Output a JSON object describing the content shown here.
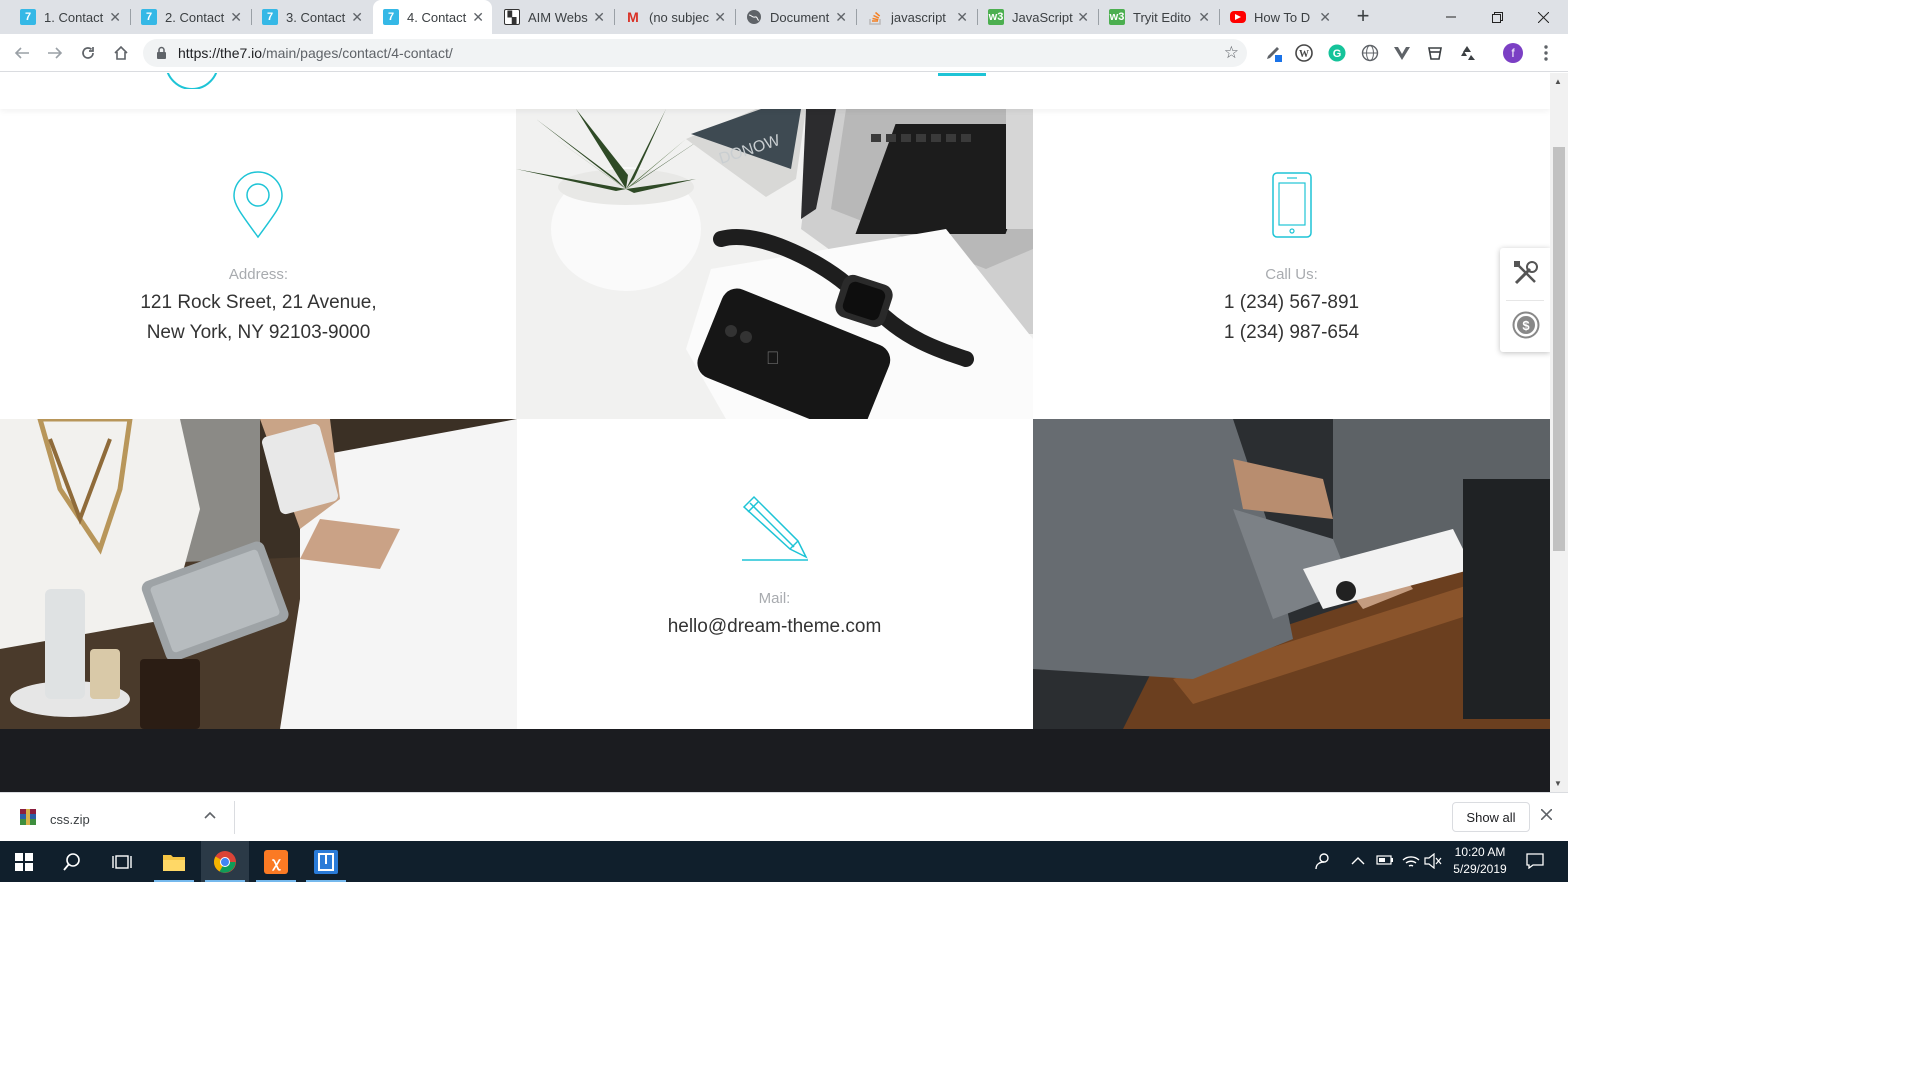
{
  "browser": {
    "tabs": [
      {
        "title": "1. Contact",
        "favicon": "the7-icon",
        "favicon_color": "#35b8e6",
        "favicon_text": "7",
        "active": false
      },
      {
        "title": "2. Contact",
        "favicon": "the7-icon",
        "favicon_color": "#35b8e6",
        "favicon_text": "7",
        "active": false
      },
      {
        "title": "3. Contact",
        "favicon": "the7-icon",
        "favicon_color": "#35b8e6",
        "favicon_text": "7",
        "active": false
      },
      {
        "title": "4. Contact",
        "favicon": "the7-icon",
        "favicon_color": "#35b8e6",
        "favicon_text": "7",
        "active": true
      },
      {
        "title": "AIM Webs",
        "favicon": "aim-icon",
        "favicon_color": "#2a2a2a",
        "favicon_text": "A",
        "active": false
      },
      {
        "title": "(no subjec",
        "favicon": "gmail-icon",
        "favicon_color": "#ffffff",
        "favicon_text": "M",
        "active": false
      },
      {
        "title": "Document",
        "favicon": "globe-icon",
        "favicon_color": "#5f6368",
        "favicon_text": "",
        "active": false
      },
      {
        "title": "javascript",
        "favicon": "stackoverflow-icon",
        "favicon_color": "#ffffff",
        "favicon_text": "",
        "active": false
      },
      {
        "title": "JavaScript",
        "favicon": "w3schools-icon",
        "favicon_color": "#4caf50",
        "favicon_text": "w3",
        "active": false
      },
      {
        "title": "Tryit Edito",
        "favicon": "w3schools-icon",
        "favicon_color": "#4caf50",
        "favicon_text": "w3",
        "active": false
      },
      {
        "title": "How To D",
        "favicon": "youtube-icon",
        "favicon_color": "#ff0000",
        "favicon_text": "",
        "active": false
      }
    ],
    "url_host": "https://the7.io",
    "url_path": "/main/pages/contact/4-contact/",
    "profile_initial": "f"
  },
  "contact": {
    "address": {
      "label": "Address:",
      "lines": [
        "121 Rock Sreet, 21 Avenue,",
        "New York, NY 92103-9000"
      ]
    },
    "phone": {
      "label": "Call Us:",
      "lines": [
        "1 (234) 567-891",
        "1 (234) 987-654"
      ]
    },
    "mail": {
      "label": "Mail:",
      "lines": [
        "hello@dream-theme.com"
      ]
    }
  },
  "accent_color": "#1ec4d6",
  "downloads": {
    "file": "css.zip",
    "show_all": "Show all"
  },
  "taskbar": {
    "time": "10:20 AM",
    "date": "5/29/2019"
  }
}
